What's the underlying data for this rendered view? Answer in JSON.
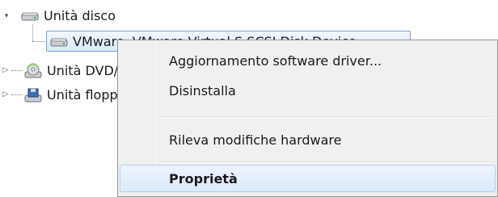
{
  "tree": {
    "disk_group": {
      "label": "Unità disco",
      "expander": "▾"
    },
    "disk_item": {
      "label": "VMware, VMware Virtual S SCSI Disk Device"
    },
    "dvd_group": {
      "label": "Unità DVD/CD-ROM",
      "expander": "▷"
    },
    "floppy_group": {
      "label": "Unità floppy",
      "expander": "▷"
    }
  },
  "context_menu": {
    "items": [
      {
        "label": "Aggiornamento software driver..."
      },
      {
        "label": "Disinstalla"
      },
      {
        "label": "Rileva modifiche hardware"
      },
      {
        "label": "Proprietà",
        "default": true
      }
    ]
  }
}
